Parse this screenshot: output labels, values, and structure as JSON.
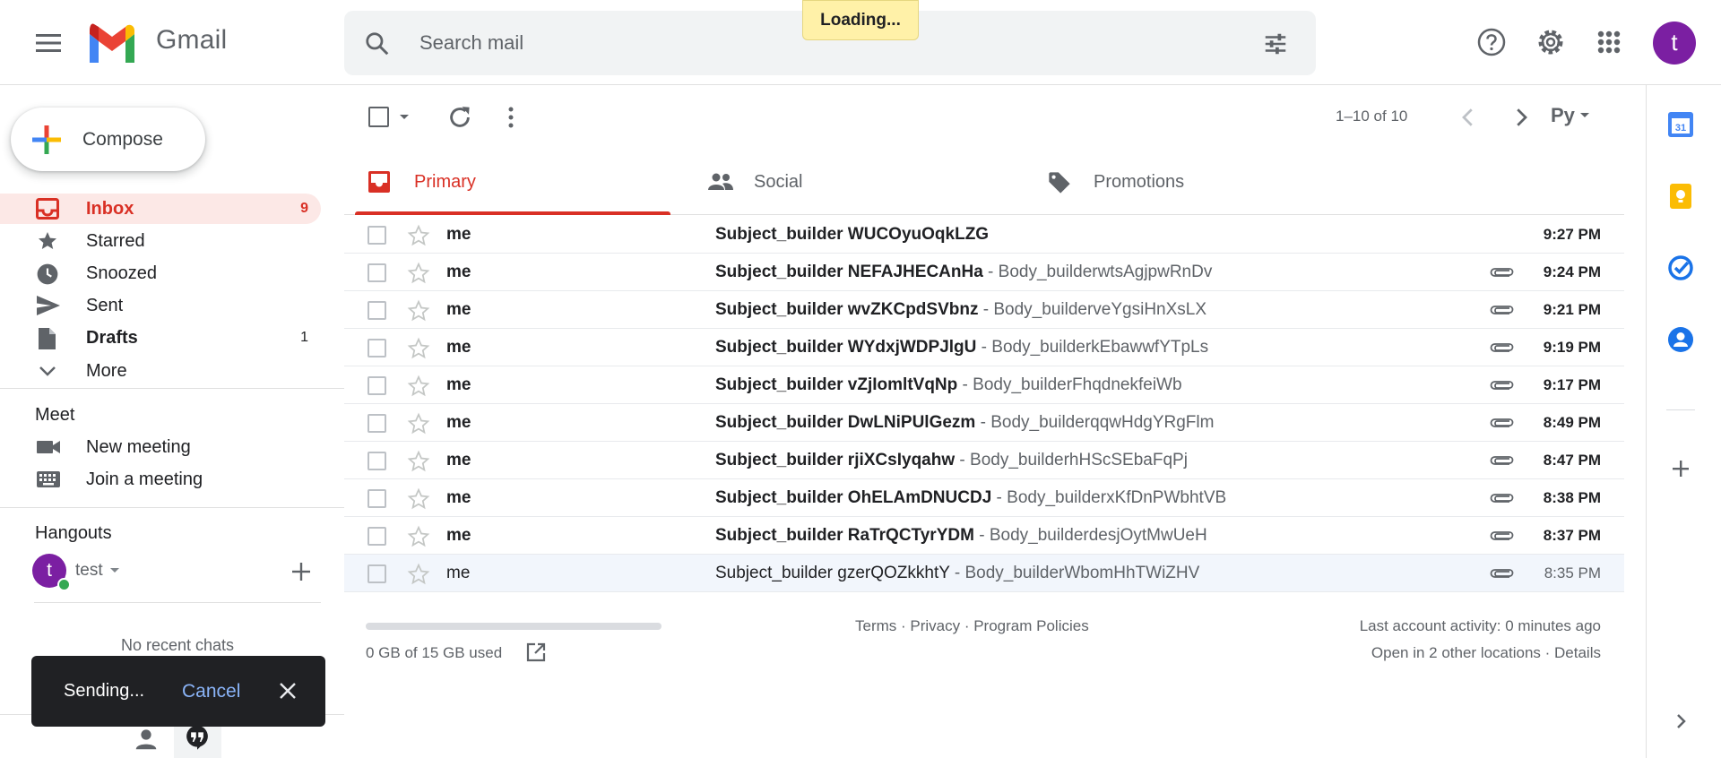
{
  "header": {
    "app_name": "Gmail",
    "search_placeholder": "Search mail",
    "loading_text": "Loading...",
    "avatar_letter": "t"
  },
  "compose": {
    "label": "Compose"
  },
  "nav": [
    {
      "label": "Inbox",
      "count": "9",
      "icon": "inbox-icon"
    },
    {
      "label": "Starred",
      "count": "",
      "icon": "star-icon"
    },
    {
      "label": "Snoozed",
      "count": "",
      "icon": "clock-icon"
    },
    {
      "label": "Sent",
      "count": "",
      "icon": "send-icon"
    },
    {
      "label": "Drafts",
      "count": "1",
      "icon": "draft-icon"
    },
    {
      "label": "More",
      "count": "",
      "icon": "chevron-down-icon"
    }
  ],
  "meet": {
    "title": "Meet",
    "new_meeting": "New meeting",
    "join_meeting": "Join a meeting"
  },
  "hangouts": {
    "title": "Hangouts",
    "user_letter": "t",
    "user_name": "test",
    "no_chats": "No recent chats"
  },
  "toolbar": {
    "pagination": "1–10 of 10",
    "input_tools_label": "Ру"
  },
  "tabs": [
    {
      "label": "Primary",
      "icon": "inbox-icon"
    },
    {
      "label": "Social",
      "icon": "people-icon"
    },
    {
      "label": "Promotions",
      "icon": "tag-icon"
    }
  ],
  "emails": [
    {
      "sender": "me",
      "subject": "Subject_builder WUCOyuOqkLZG",
      "snippet": "",
      "time": "9:27 PM",
      "attachment": false,
      "unread": true
    },
    {
      "sender": "me",
      "subject": "Subject_builder NEFAJHECAnHa",
      "snippet": "Body_builderwtsAgjpwRnDv",
      "time": "9:24 PM",
      "attachment": true,
      "unread": true
    },
    {
      "sender": "me",
      "subject": "Subject_builder wvZKCpdSVbnz",
      "snippet": "Body_builderveYgsiHnXsLX",
      "time": "9:21 PM",
      "attachment": true,
      "unread": true
    },
    {
      "sender": "me",
      "subject": "Subject_builder WYdxjWDPJlgU",
      "snippet": "Body_builderkEbawwfYTpLs",
      "time": "9:19 PM",
      "attachment": true,
      "unread": true
    },
    {
      "sender": "me",
      "subject": "Subject_builder vZjIomltVqNp",
      "snippet": "Body_builderFhqdnekfeiWb",
      "time": "9:17 PM",
      "attachment": true,
      "unread": true
    },
    {
      "sender": "me",
      "subject": "Subject_builder DwLNiPUlGezm",
      "snippet": "Body_builderqqwHdgYRgFlm",
      "time": "8:49 PM",
      "attachment": true,
      "unread": true
    },
    {
      "sender": "me",
      "subject": "Subject_builder rjiXCsIyqahw",
      "snippet": "Body_builderhHScSEbaFqPj",
      "time": "8:47 PM",
      "attachment": true,
      "unread": true
    },
    {
      "sender": "me",
      "subject": "Subject_builder OhELAmDNUCDJ",
      "snippet": "Body_builderxKfDnPWbhtVB",
      "time": "8:38 PM",
      "attachment": true,
      "unread": true
    },
    {
      "sender": "me",
      "subject": "Subject_builder RaTrQCTyrYDM",
      "snippet": "Body_builderdesjOytMwUeH",
      "time": "8:37 PM",
      "attachment": true,
      "unread": true
    },
    {
      "sender": "me",
      "subject": "Subject_builder gzerQOZkkhtY",
      "snippet": "Body_builderWbomHhTWiZHV",
      "time": "8:35 PM",
      "attachment": true,
      "unread": false
    }
  ],
  "footer": {
    "storage": "0 GB of 15 GB used",
    "links": "Terms · Privacy · Program Policies",
    "activity": "Last account activity: 0 minutes ago",
    "other_locations": "Open in 2 other locations · Details"
  },
  "snackbar": {
    "text": "Sending...",
    "action": "Cancel"
  },
  "colors": {
    "accent": "#d93025",
    "active_bg": "#fce8e6",
    "avatar": "#7b1fa2",
    "link_blue": "#8ab4f8"
  }
}
